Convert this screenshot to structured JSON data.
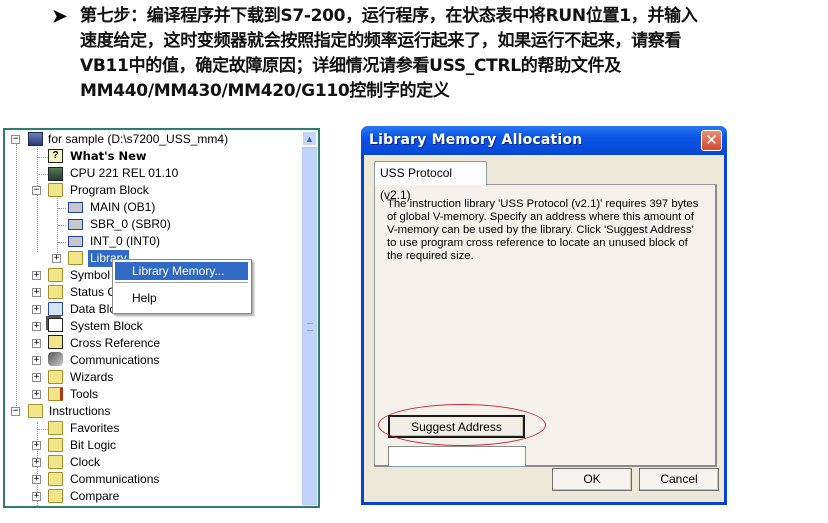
{
  "instruction": {
    "bullet": "➤",
    "lines": [
      "第七步：编译程序并下载到S7-200，运行程序，在状态表中将RUN位置1，并输入",
      "速度给定，这时变频器就会按照指定的频率运行起来了，如果运行不起来，请察看",
      "VB11中的值，确定故障原因；详细情况请参看USS_CTRL的帮助文件及",
      "MM440/MM430/MM420/G110控制字的定义"
    ]
  },
  "tree": {
    "items": [
      {
        "label": "for sample (D:\\s7200_USS_mm4)",
        "icon": "project-icon",
        "expander": "−"
      },
      {
        "label": "What's New",
        "icon": "help-icon",
        "bold": true
      },
      {
        "label": "CPU 221 REL 01.10",
        "icon": "cpu-icon"
      },
      {
        "label": "Program Block",
        "icon": "program-block-folder-icon",
        "expander": "−"
      },
      {
        "label": "MAIN (OB1)",
        "icon": "block-icon"
      },
      {
        "label": "SBR_0 (SBR0)",
        "icon": "block-icon"
      },
      {
        "label": "INT_0 (INT0)",
        "icon": "block-icon"
      },
      {
        "label": "Library",
        "icon": "library-folder-icon",
        "expander": "+",
        "selected": true
      },
      {
        "label": "Symbol Table",
        "icon": "folder-icon",
        "expander": "+"
      },
      {
        "label": "Status Chart",
        "icon": "folder-icon",
        "expander": "+"
      },
      {
        "label": "Data Block",
        "icon": "folder-icon",
        "expander": "+"
      },
      {
        "label": "System Block",
        "icon": "system-block-icon",
        "expander": "+"
      },
      {
        "label": "Cross Reference",
        "icon": "cross-reference-icon",
        "expander": "+"
      },
      {
        "label": "Communications",
        "icon": "communications-icon",
        "expander": "+"
      },
      {
        "label": "Wizards",
        "icon": "wizard-folder-icon",
        "expander": "+"
      },
      {
        "label": "Tools",
        "icon": "tools-folder-icon",
        "expander": "+"
      },
      {
        "label": "Instructions",
        "icon": "instructions-folder-icon",
        "expander": "−"
      },
      {
        "label": "Favorites",
        "icon": "favorites-folder-icon"
      },
      {
        "label": "Bit Logic",
        "icon": "bit-logic-folder-icon",
        "expander": "+"
      },
      {
        "label": "Clock",
        "icon": "clock-folder-icon",
        "expander": "+"
      },
      {
        "label": "Communications",
        "icon": "comm-folder-icon",
        "expander": "+"
      },
      {
        "label": "Compare",
        "icon": "compare-folder-icon",
        "expander": "+"
      }
    ],
    "scroll_up": "▲"
  },
  "context_menu": {
    "items": [
      "Library Memory...",
      "Help"
    ]
  },
  "dialog": {
    "title": "Library Memory Allocation",
    "close": "✕",
    "tab": "USS Protocol (v2.1)",
    "description": "The instruction library 'USS Protocol (v2.1)' requires 397 bytes of global V-memory. Specify an address where this amount of V-memory can be used by the library. Click 'Suggest Address' to use program cross reference to locate an unused block of the required size.",
    "suggest_label": "Suggest Address",
    "address_value": "",
    "ok_label": "OK",
    "cancel_label": "Cancel"
  },
  "colors": {
    "title_bar": "#0a54e3",
    "selection": "#316ac5",
    "highlight_ellipse": "#d0283a",
    "tree_border": "#2e7b73"
  }
}
